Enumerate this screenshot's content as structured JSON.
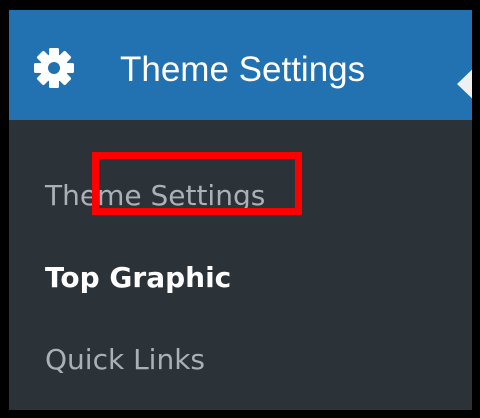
{
  "menu": {
    "header": {
      "title": "Theme Settings",
      "icon": "gear-icon",
      "background": "#2271b1"
    },
    "submenu": {
      "background": "#2c3338",
      "items": [
        {
          "label": "Theme Settings",
          "current": false
        },
        {
          "label": "Top Graphic",
          "current": true
        },
        {
          "label": "Quick Links",
          "current": false
        }
      ]
    }
  },
  "annotation": {
    "highlight_color": "#ff0000"
  }
}
